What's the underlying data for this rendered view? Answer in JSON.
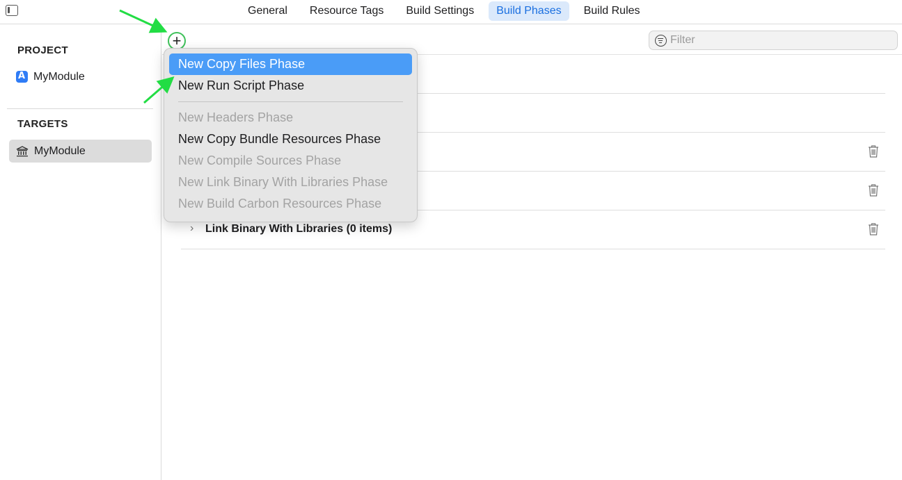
{
  "tabs": [
    {
      "label": "General"
    },
    {
      "label": "Resource Tags"
    },
    {
      "label": "Build Settings"
    },
    {
      "label": "Build Phases"
    },
    {
      "label": "Build Rules"
    }
  ],
  "sidebar": {
    "project_title": "PROJECT",
    "project_item": "MyModule",
    "targets_title": "TARGETS",
    "target_item": "MyModule"
  },
  "toolbar": {
    "add_label": "+",
    "filter_placeholder": "Filter"
  },
  "menu": {
    "items": [
      {
        "label": "New Copy Files Phase",
        "state": "highlighted"
      },
      {
        "label": "New Run Script Phase",
        "state": "enabled"
      },
      {
        "label": "New Headers Phase",
        "state": "disabled"
      },
      {
        "label": "New Copy Bundle Resources Phase",
        "state": "enabled"
      },
      {
        "label": "New Compile Sources Phase",
        "state": "disabled"
      },
      {
        "label": "New Link Binary With Libraries Phase",
        "state": "disabled"
      },
      {
        "label": "New Build Carbon Resources Phase",
        "state": "disabled"
      }
    ]
  },
  "phases": [
    {
      "label": "Link Binary With Libraries (0 items)"
    }
  ],
  "colors": {
    "accent": "#1a6fe0",
    "tab_active_bg": "#dbe9fb",
    "menu_highlight": "#4a9cf7",
    "annotation": "#22dd44"
  }
}
